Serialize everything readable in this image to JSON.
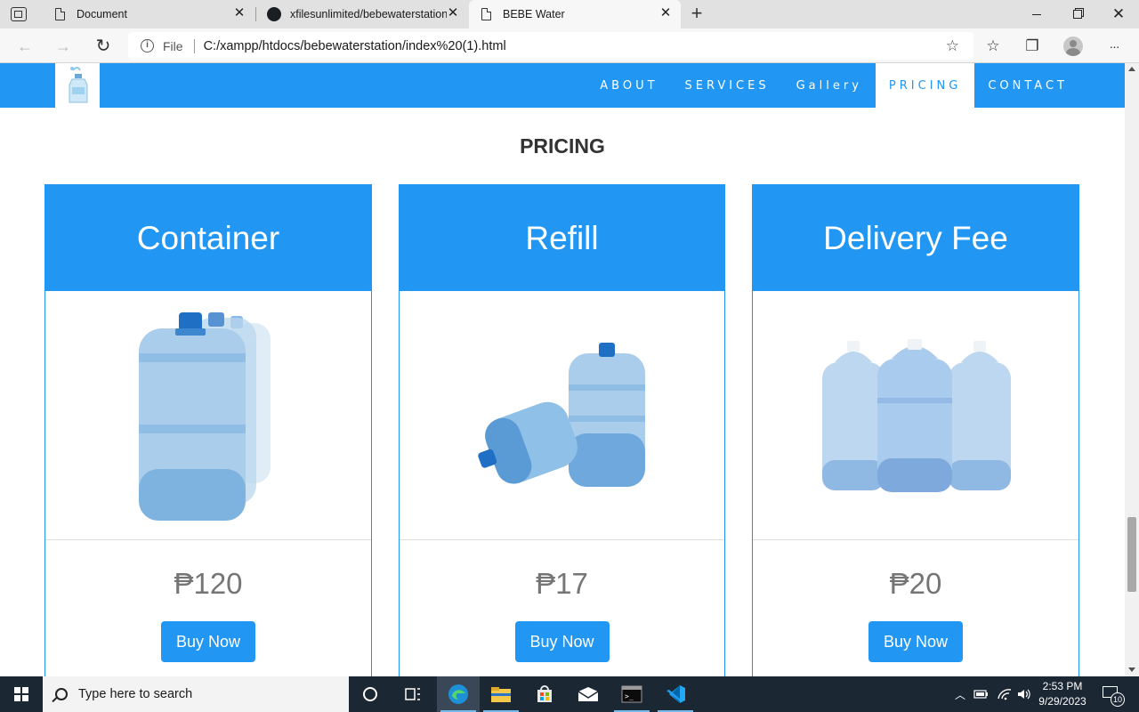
{
  "browser": {
    "tabs": [
      {
        "title": "Document",
        "icon": "page-icon",
        "active": false
      },
      {
        "title": "xfilesunlimited/bebewaterstation",
        "icon": "github-icon",
        "active": false
      },
      {
        "title": "BEBE Water",
        "icon": "page-icon",
        "active": true
      }
    ],
    "tab_close": "✕",
    "new_tab": "+",
    "address": {
      "scheme": "File",
      "url": "C:/xampp/htdocs/bebewaterstation/index%20(1).html"
    },
    "buttons": {
      "back": "←",
      "forward": "→",
      "refresh": "↻",
      "more": "···"
    }
  },
  "site": {
    "nav": {
      "items": [
        "ABOUT",
        "SERVICES",
        "Gallery",
        "PRICING",
        "CONTACT"
      ],
      "active": "PRICING"
    },
    "section_title": "PRICING",
    "cards": [
      {
        "title": "Container",
        "price": "₱120",
        "button": "Buy Now",
        "image": "stacked-water-jugs"
      },
      {
        "title": "Refill",
        "price": "₱17",
        "button": "Buy Now",
        "image": "lying-and-standing-jugs"
      },
      {
        "title": "Delivery Fee",
        "price": "₱20",
        "button": "Buy Now",
        "image": "three-water-jugs"
      }
    ]
  },
  "taskbar": {
    "search_placeholder": "Type here to search",
    "time": "2:53 PM",
    "date": "9/29/2023",
    "notification_count": "10"
  },
  "colors": {
    "brand_blue": "#2196f3",
    "price_grey": "#757575",
    "taskbar_bg": "#1c2734"
  }
}
